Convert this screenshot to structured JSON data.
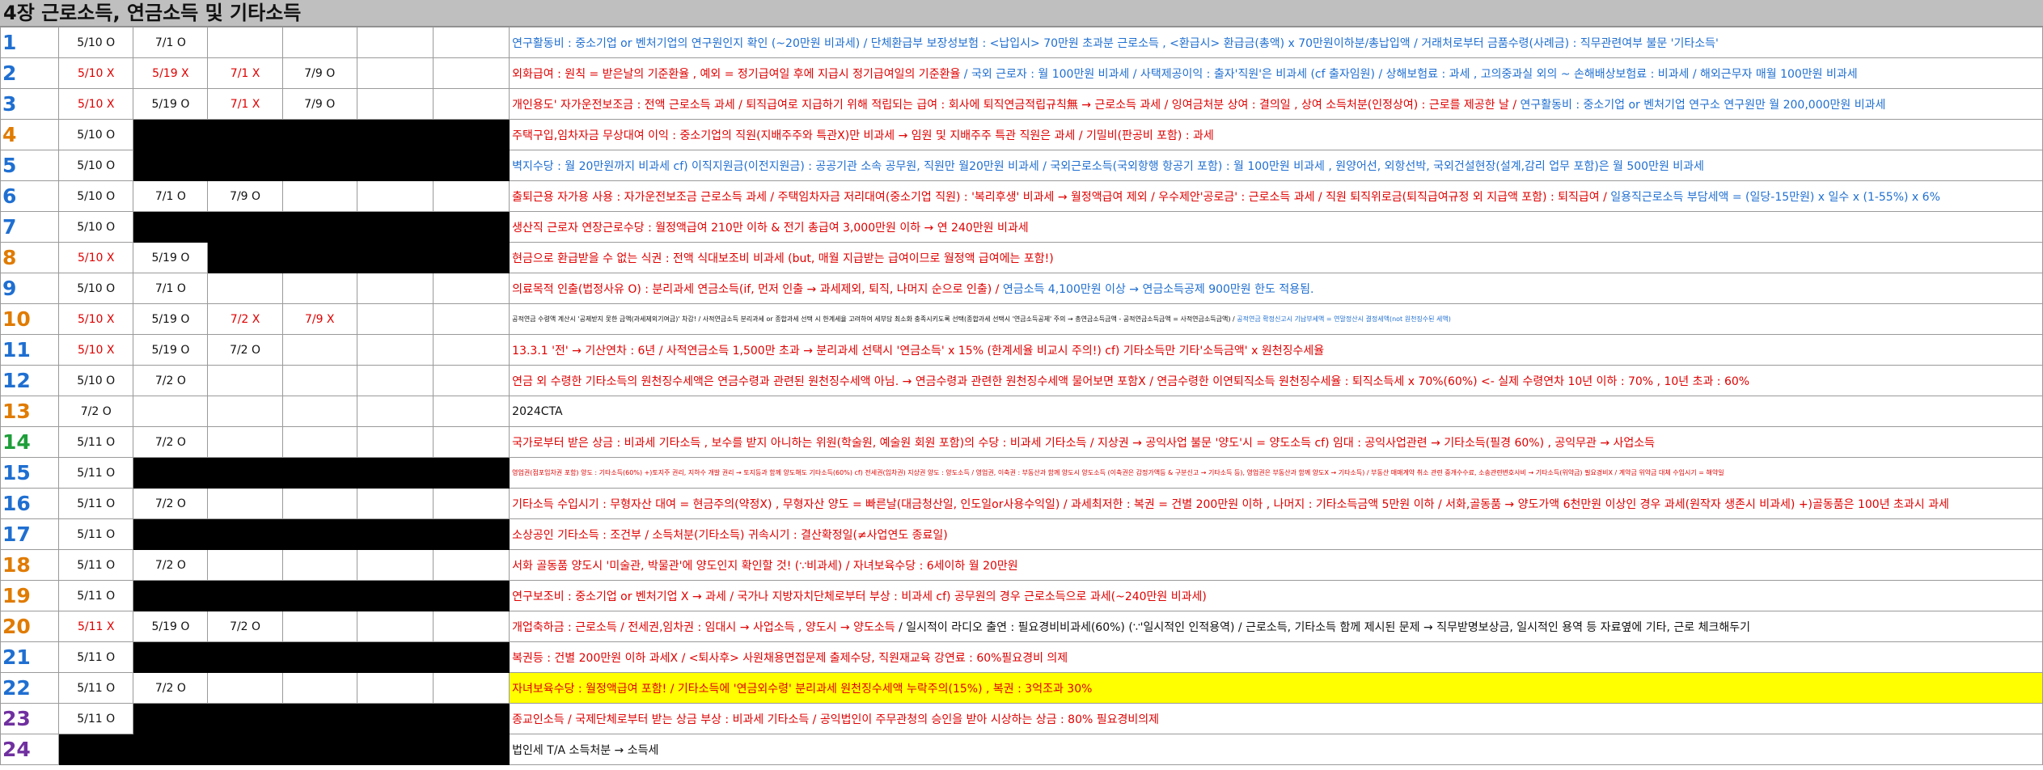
{
  "title": "4장 근로소득, 연금소득 및 기타소득",
  "rows": [
    {
      "num": "1",
      "num_color": "blue",
      "d1": "5/10  O",
      "d2": "7/1  O",
      "d3": "",
      "d4": "",
      "d1_red": false,
      "d2_red": false,
      "d3_red": false,
      "d4_red": false,
      "blackout": false,
      "note_parts": [
        {
          "t": "연구활동비 : 중소기업 or 벤처기업의 연구원인지 확인 (~20만원 비과세) / 단체환급부 보장성보험 : <납입시> 70만원 초과분 근로소득 , <환급시> 환급금(총액) x 70만원이하분/총납입액 /  거래처로부터 금품수령(사례금) : 직무관련여부 불문 '기타소득'",
          "c": "blue"
        }
      ],
      "note_size": "",
      "highlight": false
    },
    {
      "num": "2",
      "num_color": "blue",
      "d1": "5/10  X",
      "d2": "5/19  X",
      "d3": "7/1  X",
      "d4": "7/9  O",
      "d1_red": true,
      "d2_red": true,
      "d3_red": true,
      "d4_red": false,
      "blackout": false,
      "note_parts": [
        {
          "t": "외화급여 : 원칙 = 받은날의 기준환율 , 예외 = 정기급여일 후에 지급시 정기급여일의 기준환율 ",
          "c": "red"
        },
        {
          "t": "/ 국외 근로자 : 월 100만원 비과세 / 사택제공이익 : 출자'직원'은 비과세 (cf 출자임원) / 상해보험료 : 과세 , 고의중과실 외의 ~ 손해배상보험료 : 비과세 / 해외근무자 매월 100만원 비과세",
          "c": "blue"
        }
      ],
      "note_size": "",
      "highlight": false
    },
    {
      "num": "3",
      "num_color": "blue",
      "d1": "5/10  X",
      "d2": "5/19  O",
      "d3": "7/1  X",
      "d4": "7/9  O",
      "d1_red": true,
      "d2_red": false,
      "d3_red": true,
      "d4_red": false,
      "blackout": false,
      "note_parts": [
        {
          "t": "개인용도' 자가운전보조금 : 전액 근로소득 과세 / 퇴직급여로 지급하기 위해 적립되는 급여 : 회사에 퇴직연금적립규칙無 → 근로소득 과세 / 잉여금처분 상여 : 결의일  ,  상여 소득처분(인정상여) : 근로를 제공한 날 / ",
          "c": "red"
        },
        {
          "t": "연구활동비 : 중소기업 or 벤처기업 연구소 연구원만 월 200,000만원 비과세",
          "c": "blue"
        }
      ],
      "note_size": "",
      "highlight": false
    },
    {
      "num": "4",
      "num_color": "orange",
      "d1": "5/10  O",
      "d2": "",
      "d3": "",
      "d4": "",
      "d1_red": false,
      "d2_red": false,
      "d3_red": false,
      "d4_red": false,
      "blackout": true,
      "note_parts": [
        {
          "t": "주택구입,임차자금 무상대여 이익 : 중소기업의 직원(지배주주와 특관X)만 비과세 → 임원 및 지배주주 특관 직원은 과세 / 기밀비(판공비 포함) : 과세",
          "c": "red"
        }
      ],
      "note_size": "",
      "highlight": false
    },
    {
      "num": "5",
      "num_color": "blue",
      "d1": "5/10  O",
      "d2": "",
      "d3": "",
      "d4": "",
      "d1_red": false,
      "d2_red": false,
      "d3_red": false,
      "d4_red": false,
      "blackout": true,
      "note_parts": [
        {
          "t": "벽지수당 : 월 20만원까지 비과세  cf) 이직지원금(이전지원금) : 공공기관 소속 공무원, 직원만 월20만원 비과세  /  국외근로소득(국외항행 항공기 포함) : 월 100만원 비과세  ,  원양어선, 외항선박, 국외건설현장(설계,감리 업무 포함)은 월 500만원 비과세",
          "c": "blue"
        }
      ],
      "note_size": "",
      "highlight": false
    },
    {
      "num": "6",
      "num_color": "blue",
      "d1": "5/10  O",
      "d2": "7/1  O",
      "d3": "7/9  O",
      "d4": "",
      "d1_red": false,
      "d2_red": false,
      "d3_red": false,
      "d4_red": false,
      "blackout": false,
      "note_parts": [
        {
          "t": "출퇴근용 자가용 사용 : 자가운전보조금 근로소득 과세 / 주택임차자금 저리대여(중소기업 직원) : '복리후생' 비과세 → 월정액급여 제외 / 우수제안'공로금' : 근로소득 과세 / 직원 퇴직위로금(퇴직급여규정 외 지급액 포함) : 퇴직급여 / ",
          "c": "red"
        },
        {
          "t": "일용직근로소득 부담세액 = (일당-15만원) x 일수 x (1-55%) x 6%",
          "c": "blue"
        }
      ],
      "note_size": "",
      "highlight": false
    },
    {
      "num": "7",
      "num_color": "blue",
      "d1": "5/10  O",
      "d2": "",
      "d3": "",
      "d4": "",
      "d1_red": false,
      "d2_red": false,
      "d3_red": false,
      "d4_red": false,
      "blackout": true,
      "note_parts": [
        {
          "t": "생산직 근로자 연장근로수당 : 월정액급여 210만 이하 & 전기 총급여 3,000만원 이하 → 연 240만원 비과세",
          "c": "red"
        }
      ],
      "note_size": "",
      "highlight": false
    },
    {
      "num": "8",
      "num_color": "orange",
      "d1": "5/10  X",
      "d2": "5/19  O",
      "d3": "",
      "d4": "",
      "d1_red": true,
      "d2_red": false,
      "d3_red": false,
      "d4_red": false,
      "blackout": true,
      "note_parts": [
        {
          "t": "현금으로 환급받을 수 없는 식권 : 전액 식대보조비 비과세 (but, 매월 지급받는 급여이므로 월정액 급여에는 포함!)",
          "c": "red"
        }
      ],
      "note_size": "",
      "highlight": false
    },
    {
      "num": "9",
      "num_color": "blue",
      "d1": "5/10  O",
      "d2": "7/1  O",
      "d3": "",
      "d4": "",
      "d1_red": false,
      "d2_red": false,
      "d3_red": false,
      "d4_red": false,
      "blackout": false,
      "note_parts": [
        {
          "t": "의료목적 인출(법정사유 O) : 분리과세 연금소득(if, 먼저 인출 → 과세제외, 퇴직, 나머지 순으로 인출) / ",
          "c": "red"
        },
        {
          "t": "연금소득 4,100만원 이상 → 연금소득공제 900만원 한도 적용됨.",
          "c": "blue"
        }
      ],
      "note_size": "",
      "highlight": false
    },
    {
      "num": "10",
      "num_color": "orange",
      "d1": "5/10  X",
      "d2": "5/19  O",
      "d3": "7/2  X",
      "d4": "7/9  X",
      "d1_red": true,
      "d2_red": false,
      "d3_red": true,
      "d4_red": true,
      "blackout": false,
      "note_parts": [
        {
          "t": "공적연금 수령액 계산시 '공제받지 못한 금액(과세제외기여금)' 차감! / 사적연금소득 분리과세 or 종합과세 선택 시 한계세율 고려하여 세부담 최소화 충족시키도록 선택(종합과세 선택시 '연금소득공제' 주의 → 총연금소득금액 - 공적연금소득금액 = 사적연금소득금액)  /  ",
          "c": "blk"
        },
        {
          "t": "공적연금 확정신고시 기납부세액 = 연말정산시 결정세액(not 원천징수된 세액)",
          "c": "blue"
        }
      ],
      "note_size": "tiny",
      "highlight": false
    },
    {
      "num": "11",
      "num_color": "blue",
      "d1": "5/10  X",
      "d2": "5/19  O",
      "d3": "7/2  O",
      "d4": "",
      "d1_red": true,
      "d2_red": false,
      "d3_red": false,
      "d4_red": false,
      "blackout": false,
      "note_parts": [
        {
          "t": "13.3.1 '전' → 기산연차 : 6년 / 사적연금소득 1,500만 초과 → 분리과세 선택시 '연금소득' x 15% (한계세율 비교시 주의!)     cf) 기타소득만 기타'소득금액' x 원천징수세율",
          "c": "red"
        }
      ],
      "note_size": "",
      "highlight": false
    },
    {
      "num": "12",
      "num_color": "blue",
      "d1": "5/10  O",
      "d2": "7/2  O",
      "d3": "",
      "d4": "",
      "d1_red": false,
      "d2_red": false,
      "d3_red": false,
      "d4_red": false,
      "blackout": false,
      "note_parts": [
        {
          "t": "연금 외 수령한 기타소득의 원천징수세액은 연금수령과 관련된 원천징수세액 아님. → 연금수령과 관련한 원천징수세액 물어보면 포함X / 연금수령한 이연퇴직소득 원천징수세율 : 퇴직소득세 x 70%(60%) <- 실제 수령연차 10년 이하 : 70% , 10년 초과 : 60%",
          "c": "red"
        }
      ],
      "note_size": "",
      "highlight": false
    },
    {
      "num": "13",
      "num_color": "orange",
      "d1": "7/2  O",
      "d2": "",
      "d3": "",
      "d4": "",
      "d1_red": false,
      "d2_red": false,
      "d3_red": false,
      "d4_red": false,
      "blackout": false,
      "note_parts": [
        {
          "t": "2024CTA",
          "c": "blk"
        }
      ],
      "note_size": "",
      "highlight": false
    },
    {
      "num": "14",
      "num_color": "green",
      "d1": "5/11  O",
      "d2": "7/2  O",
      "d3": "",
      "d4": "",
      "d1_red": false,
      "d2_red": false,
      "d3_red": false,
      "d4_red": false,
      "blackout": false,
      "note_parts": [
        {
          "t": "국가로부터 받은 상금 : 비과세 기타소득 , 보수를 받지 아니하는 위원(학술원, 예술원 회원 포함)의 수당 : 비과세 기타소득 / 지상권 → 공익사업 불문 '양도'시 = 양도소득  cf) 임대 : 공익사업관련 → 기타소득(필경 60%) , 공익무관 → 사업소득",
          "c": "red"
        }
      ],
      "note_size": "",
      "highlight": false
    },
    {
      "num": "15",
      "num_color": "blue",
      "d1": "5/11  O",
      "d2": "",
      "d3": "",
      "d4": "",
      "d1_red": false,
      "d2_red": false,
      "d3_red": false,
      "d4_red": false,
      "blackout": true,
      "note_parts": [
        {
          "t": "영업권(점포임차권 포함) 양도 : 기타소득(60%) +)토지주 권리, 지하수 개발 권리 → 토지등과 함께 양도해도 기타소득(60%)  cf) 전세권(임차권) 지상권 양도 : 양도소득 / 영업권, 이축권 : 부동산과 함께 양도시 양도소득 (이축권은 감정가액등 & 구분신고 → 기타소득 등), 영업권은 부동산과 함께 양도X → 기타소득) / 부동산 매매계약 취소 관련 중개수수료, 소송관련변호사비 → 기타소득(위약금) 필요경비X  /  계약금 위약금 대체 수입시기 = 해약일",
          "c": "red"
        }
      ],
      "note_size": "tiny",
      "highlight": false
    },
    {
      "num": "16",
      "num_color": "blue",
      "d1": "5/11  O",
      "d2": "7/2  O",
      "d3": "",
      "d4": "",
      "d1_red": false,
      "d2_red": false,
      "d3_red": false,
      "d4_red": false,
      "blackout": false,
      "note_parts": [
        {
          "t": "기타소득 수입시기 : 무형자산 대여 = 현금주의(약정X) , 무형자산 양도 = 빠른날(대금청산일, 인도일or사용수익일) / 과세최저한 : 복권 = 건별 200만원 이하 , 나머지 : 기타소득금액 5만원 이하 / 서화,골동품 → 양도가액 6천만원 이상인 경우 과세(원작자 생존시 비과세)   +)골동품은 100년 초과시 과세",
          "c": "red"
        }
      ],
      "note_size": "",
      "highlight": false
    },
    {
      "num": "17",
      "num_color": "blue",
      "d1": "5/11  O",
      "d2": "",
      "d3": "",
      "d4": "",
      "d1_red": false,
      "d2_red": false,
      "d3_red": false,
      "d4_red": false,
      "blackout": true,
      "note_parts": [
        {
          "t": "소상공인 기타소득 : 조건부  / 소득처분(기타소득) 귀속시기 : 결산확정일(≠사업연도 종료일)",
          "c": "red"
        }
      ],
      "note_size": "",
      "highlight": false
    },
    {
      "num": "18",
      "num_color": "orange",
      "d1": "5/11  O",
      "d2": "7/2  O",
      "d3": "",
      "d4": "",
      "d1_red": false,
      "d2_red": false,
      "d3_red": false,
      "d4_red": false,
      "blackout": false,
      "note_parts": [
        {
          "t": "서화 골동품 양도시 '미술관, 박물관'에 양도인지 확인할 것! (∵비과세) / 자녀보육수당 : 6세이하 월 20만원",
          "c": "red"
        }
      ],
      "note_size": "",
      "highlight": false
    },
    {
      "num": "19",
      "num_color": "orange",
      "d1": "5/11  O",
      "d2": "",
      "d3": "",
      "d4": "",
      "d1_red": false,
      "d2_red": false,
      "d3_red": false,
      "d4_red": false,
      "blackout": true,
      "note_parts": [
        {
          "t": "연구보조비 : 중소기업 or 벤처기업 X → 과세 / 국가나 지방자치단체로부터 부상 : 비과세  cf) 공무원의 경우 근로소득으로 과세(~240만원 비과세)",
          "c": "red"
        }
      ],
      "note_size": "",
      "highlight": false
    },
    {
      "num": "20",
      "num_color": "orange",
      "d1": "5/11  X",
      "d2": "5/19  O",
      "d3": "7/2  O",
      "d4": "",
      "d1_red": true,
      "d2_red": false,
      "d3_red": false,
      "d4_red": false,
      "blackout": false,
      "note_parts": [
        {
          "t": "개업축하금 : 근로소득  /  전세권,임차권 : 임대시 → 사업소득 , 양도시 → 양도소득 ",
          "c": "red"
        },
        {
          "t": "/ 일시적이 라디오 출연 : 필요경비비과세(60%) (∵'일시적인 인적용역) / 근로소득, 기타소득 함께 제시된 문제 → 직무받명보상금, 일시적인 용역 등 자료옆에 기타, 근로 체크해두기",
          "c": "blk"
        }
      ],
      "note_size": "",
      "highlight": false
    },
    {
      "num": "21",
      "num_color": "blue",
      "d1": "5/11  O",
      "d2": "",
      "d3": "",
      "d4": "",
      "d1_red": false,
      "d2_red": false,
      "d3_red": false,
      "d4_red": false,
      "blackout": true,
      "note_parts": [
        {
          "t": "복권등 : 건별 200만원 이하 과세X  /  <퇴사후> 사원채용면접문제 출제수당, 직원재교육 강연료 : 60%필요경비 의제",
          "c": "red"
        }
      ],
      "note_size": "",
      "highlight": false
    },
    {
      "num": "22",
      "num_color": "blue",
      "d1": "5/11  O",
      "d2": "7/2  O",
      "d3": "",
      "d4": "",
      "d1_red": false,
      "d2_red": false,
      "d3_red": false,
      "d4_red": false,
      "blackout": false,
      "note_parts": [
        {
          "t": "자녀보육수당 : 월정액급여 포함! / 기타소득에 '연금외수령' 분리과세 원천징수세액 누락주의(15%) , 복권 : 3억조과 30%",
          "c": "red"
        }
      ],
      "note_size": "",
      "highlight": true
    },
    {
      "num": "23",
      "num_color": "purple",
      "d1": "5/11  O",
      "d2": "",
      "d3": "",
      "d4": "",
      "d1_red": false,
      "d2_red": false,
      "d3_red": false,
      "d4_red": false,
      "blackout": true,
      "note_parts": [
        {
          "t": "종교인소득 / 국제단체로부터 받는 상금 부상 : 비과세 기타소득 / 공익법인이 주무관청의 승인을 받아 시상하는 상금 : 80% 필요경비의제",
          "c": "red"
        }
      ],
      "note_size": "",
      "highlight": false
    },
    {
      "num": "24",
      "num_color": "purple",
      "d1": "",
      "d2": "",
      "d3": "",
      "d4": "",
      "d1_red": false,
      "d2_red": false,
      "d3_red": false,
      "d4_red": false,
      "blackout": "full",
      "note_parts": [
        {
          "t": "법인세 T/A 소득처분 → 소득세",
          "c": "blk"
        }
      ],
      "note_size": "",
      "highlight": false
    }
  ]
}
